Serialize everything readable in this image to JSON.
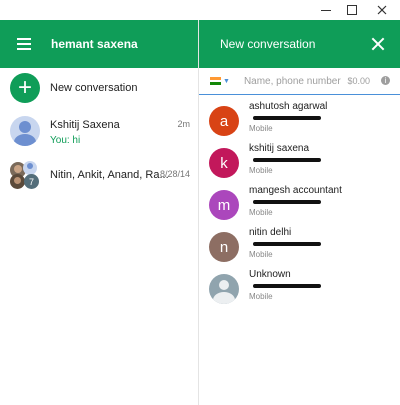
{
  "window": {
    "minimize": "minimize",
    "maximize": "maximize",
    "close": "close"
  },
  "left": {
    "user_name": "hemant saxena",
    "new_conversation_label": "New conversation",
    "conversations": [
      {
        "title": "Kshitij Saxena",
        "subtitle": "You: hi",
        "time": "2m"
      },
      {
        "title": "Nitin, Ankit, Anand, Ra...",
        "subtitle": "",
        "time": "8/28/14",
        "group_count": "7"
      }
    ]
  },
  "right": {
    "title": "New conversation",
    "search": {
      "placeholder": "Name, phone number",
      "rate": "$0.00"
    },
    "contacts": [
      {
        "initial": "a",
        "name": "ashutosh agarwal",
        "type": "Mobile",
        "color": "#d84315"
      },
      {
        "initial": "k",
        "name": "kshitij saxena",
        "type": "Mobile",
        "color": "#c2185b"
      },
      {
        "initial": "m",
        "name": "mangesh accountant",
        "type": "Mobile",
        "color": "#ab47bc"
      },
      {
        "initial": "n",
        "name": "nitin delhi",
        "type": "Mobile",
        "color": "#8d6e63"
      },
      {
        "initial": "",
        "name": "Unknown",
        "type": "Mobile",
        "color": "#90a4ae"
      }
    ]
  },
  "colors": {
    "brand": "#0f9d58",
    "accent": "#4a90d9"
  }
}
